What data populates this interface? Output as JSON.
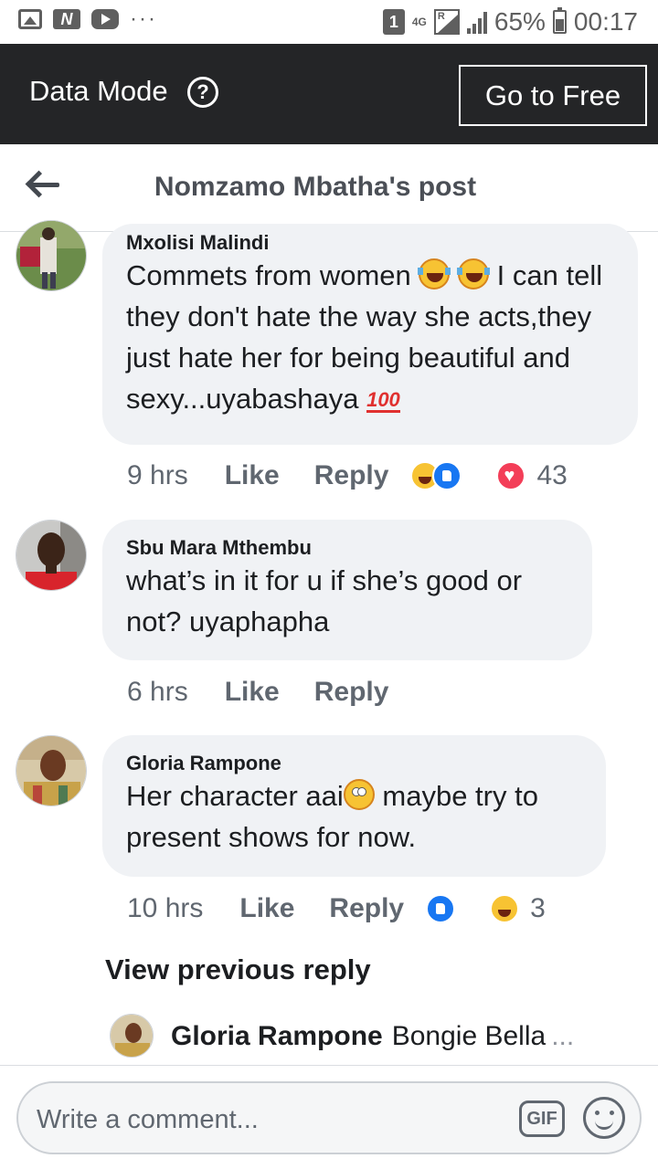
{
  "status_bar": {
    "sim_badge": "1",
    "network": "4G",
    "roaming": "R",
    "battery": "65%",
    "battery_level": 0.65,
    "time": "00:17",
    "icons": [
      "image-icon",
      "n-app-icon",
      "youtube-icon",
      "more-dots-icon",
      "signal-icon",
      "battery-icon"
    ]
  },
  "data_bar": {
    "label": "Data Mode",
    "help_icon": "?",
    "go_free_label": "Go to Free"
  },
  "header": {
    "title": "Nomzamo Mbatha's post",
    "back_icon": "arrow-left-icon"
  },
  "comments": [
    {
      "author": "Mxolisi Malindi",
      "text_before_emoji": "Commets from women ",
      "text_after_emoji": " I can tell they don't hate the way she acts,they just hate her for being beautiful and sexy...uyabashaya ",
      "emojis": [
        "laughing-tears-emoji",
        "laughing-tears-emoji",
        "hundred-emoji"
      ],
      "hundred_glyph": "100",
      "time": "9 hrs",
      "like_label": "Like",
      "reply_label": "Reply",
      "reactions": [
        "haha",
        "like",
        "love"
      ],
      "reaction_count": "43"
    },
    {
      "author": "Sbu Mara Mthembu",
      "text": "what’s in it for u if she’s good or not? uyaphapha",
      "time": "6 hrs",
      "like_label": "Like",
      "reply_label": "Reply"
    },
    {
      "author": "Gloria Rampone",
      "text_before_emoji": "Her character aai",
      "text_after_emoji": " maybe try to present shows for now.",
      "emojis": [
        "eye-roll-emoji"
      ],
      "time": "10 hrs",
      "like_label": "Like",
      "reply_label": "Reply",
      "reactions": [
        "like",
        "haha"
      ],
      "reaction_count": "3"
    }
  ],
  "view_previous": "View previous reply",
  "reply_preview": {
    "author": "Gloria Rampone",
    "text": "Bongie Bella",
    "ellipsis": "..."
  },
  "composer": {
    "placeholder": "Write a comment...",
    "gif_label": "GIF",
    "emoji_icon": "smiley-icon"
  },
  "colors": {
    "data_bar_bg": "#242527",
    "bubble_bg": "#f0f2f5",
    "meta_text": "#606770",
    "like_blue": "#1877f2",
    "love_red": "#f33e58"
  }
}
